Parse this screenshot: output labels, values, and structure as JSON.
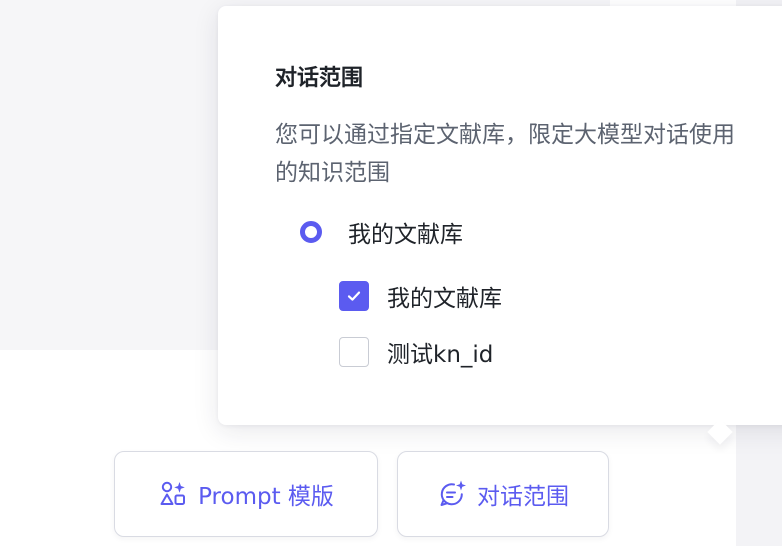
{
  "colors": {
    "accent": "#5b5bf0",
    "text_primary": "#1f2329",
    "text_secondary": "#5c6370",
    "background_panel": "#f6f6f8"
  },
  "popover": {
    "title": "对话范围",
    "description": "您可以通过指定文献库，限定大模型对话使用的知识范围",
    "radio": {
      "label": "我的文献库",
      "selected": true
    },
    "checkboxes": [
      {
        "label": "我的文献库",
        "checked": true
      },
      {
        "label": "测试kn_id",
        "checked": false
      }
    ]
  },
  "buttons": {
    "prompt": {
      "label": "Prompt 模版",
      "icon": "shapes-sparkle-icon"
    },
    "scope": {
      "label": "对话范围",
      "icon": "chat-sparkle-icon"
    }
  }
}
